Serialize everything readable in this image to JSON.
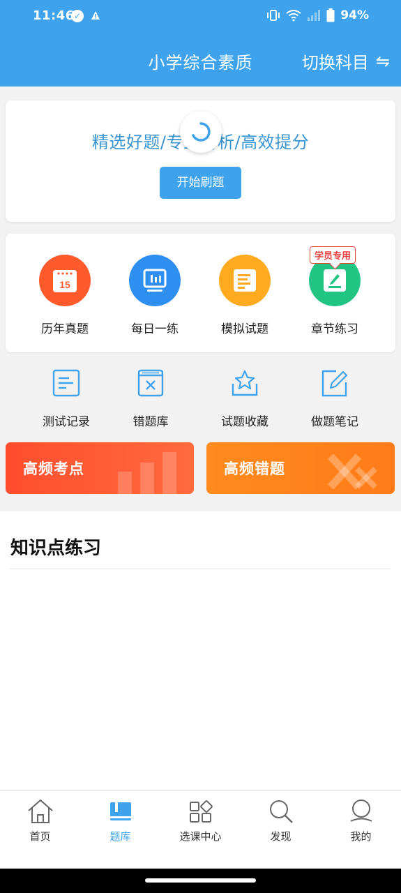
{
  "status_bar": {
    "time": "11:46",
    "battery": "94%"
  },
  "header": {
    "title": "小学综合素质",
    "switch_label": "切换科目",
    "switch_icon": "⇋"
  },
  "hero": {
    "slogan": "精选好题/专业解析/高效提分",
    "button_label": "开始刷题"
  },
  "grid": {
    "items": [
      {
        "label": "历年真题",
        "icon": "calendar-icon",
        "color": "#ff5a2c",
        "day": "15"
      },
      {
        "label": "每日一练",
        "icon": "chart-board-icon",
        "color": "#2f8ff0"
      },
      {
        "label": "模拟试题",
        "icon": "document-icon",
        "color": "#ffaa1f"
      },
      {
        "label": "章节练习",
        "icon": "edit-note-icon",
        "color": "#22c484"
      }
    ],
    "badge": "学员专用"
  },
  "tools": {
    "items": [
      {
        "label": "测试记录",
        "icon": "record-icon"
      },
      {
        "label": "错题库",
        "icon": "wrong-box-icon"
      },
      {
        "label": "试题收藏",
        "icon": "star-box-icon"
      },
      {
        "label": "做题笔记",
        "icon": "note-pen-icon"
      }
    ]
  },
  "banners": {
    "left": "高频考点",
    "right": "高频错题"
  },
  "knowledge": {
    "title": "知识点练习"
  },
  "tabbar": {
    "items": [
      {
        "label": "首页",
        "icon": "home-icon"
      },
      {
        "label": "题库",
        "icon": "question-bank-icon"
      },
      {
        "label": "选课中心",
        "icon": "apps-icon"
      },
      {
        "label": "发现",
        "icon": "search-icon"
      },
      {
        "label": "我的",
        "icon": "profile-icon"
      }
    ],
    "active": "题库"
  },
  "colors": {
    "primary": "#3ea3ec",
    "slogan": "#3894d0",
    "banner_left": "#ff4d2e",
    "banner_right": "#ff8a1d"
  }
}
